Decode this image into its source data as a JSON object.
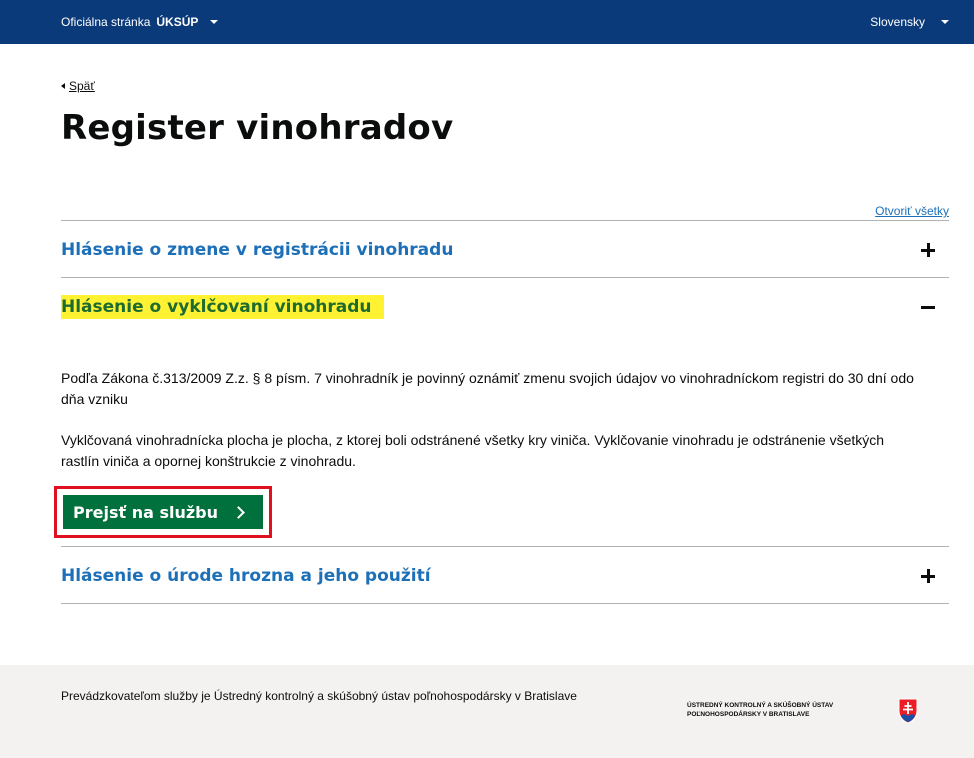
{
  "topbar": {
    "site_prefix": "Oficiálna stránka",
    "site_name": "ÚKSÚP",
    "language": "Slovensky"
  },
  "back_label": "Späť",
  "page_title": "Register vinohradov",
  "open_all_label": "Otvoriť všetky",
  "accordion": [
    {
      "title": "Hlásenie o zmene v registrácii vinohradu",
      "expanded": false
    },
    {
      "title": "Hlásenie o vyklčovaní vinohradu",
      "expanded": true,
      "paragraphs": [
        "Podľa Zákona č.313/2009 Z.z. § 8 písm. 7 vinohradník je povinný oznámiť zmenu svojich údajov vo vinohradníckom registri do 30 dní odo dňa vzniku",
        "Vyklčovaná vinohradnícka plocha je plocha, z ktorej boli odstránené všetky kry viniča. Vyklčovanie vinohradu je odstránenie všetkých rastlín viniča a opornej konštrukcie z vinohradu."
      ],
      "button_label": "Prejsť na službu"
    },
    {
      "title": "Hlásenie o úrode hrozna a jeho použití",
      "expanded": false
    }
  ],
  "footer": {
    "operator_text": "Prevádzkovateľom služby je Ústredný kontrolný a skúšobný ústav poľnohospodársky v Bratislave",
    "org_line1": "ÚSTREDNÝ KONTROLNÝ A SKÚŠOBNÝ ÚSTAV",
    "org_line2": "POĽNOHOSPODÁRSKY V BRATISLAVE"
  },
  "colors": {
    "topbar": "#0b3a7a",
    "link": "#1d70b8",
    "button": "#00703c",
    "highlight": "#fff233",
    "annotation": "#e01020"
  },
  "icons": [
    "chevron-down-icon",
    "back-arrow-icon",
    "plus-icon",
    "minus-icon",
    "chevron-right-icon",
    "coat-of-arms-icon"
  ]
}
